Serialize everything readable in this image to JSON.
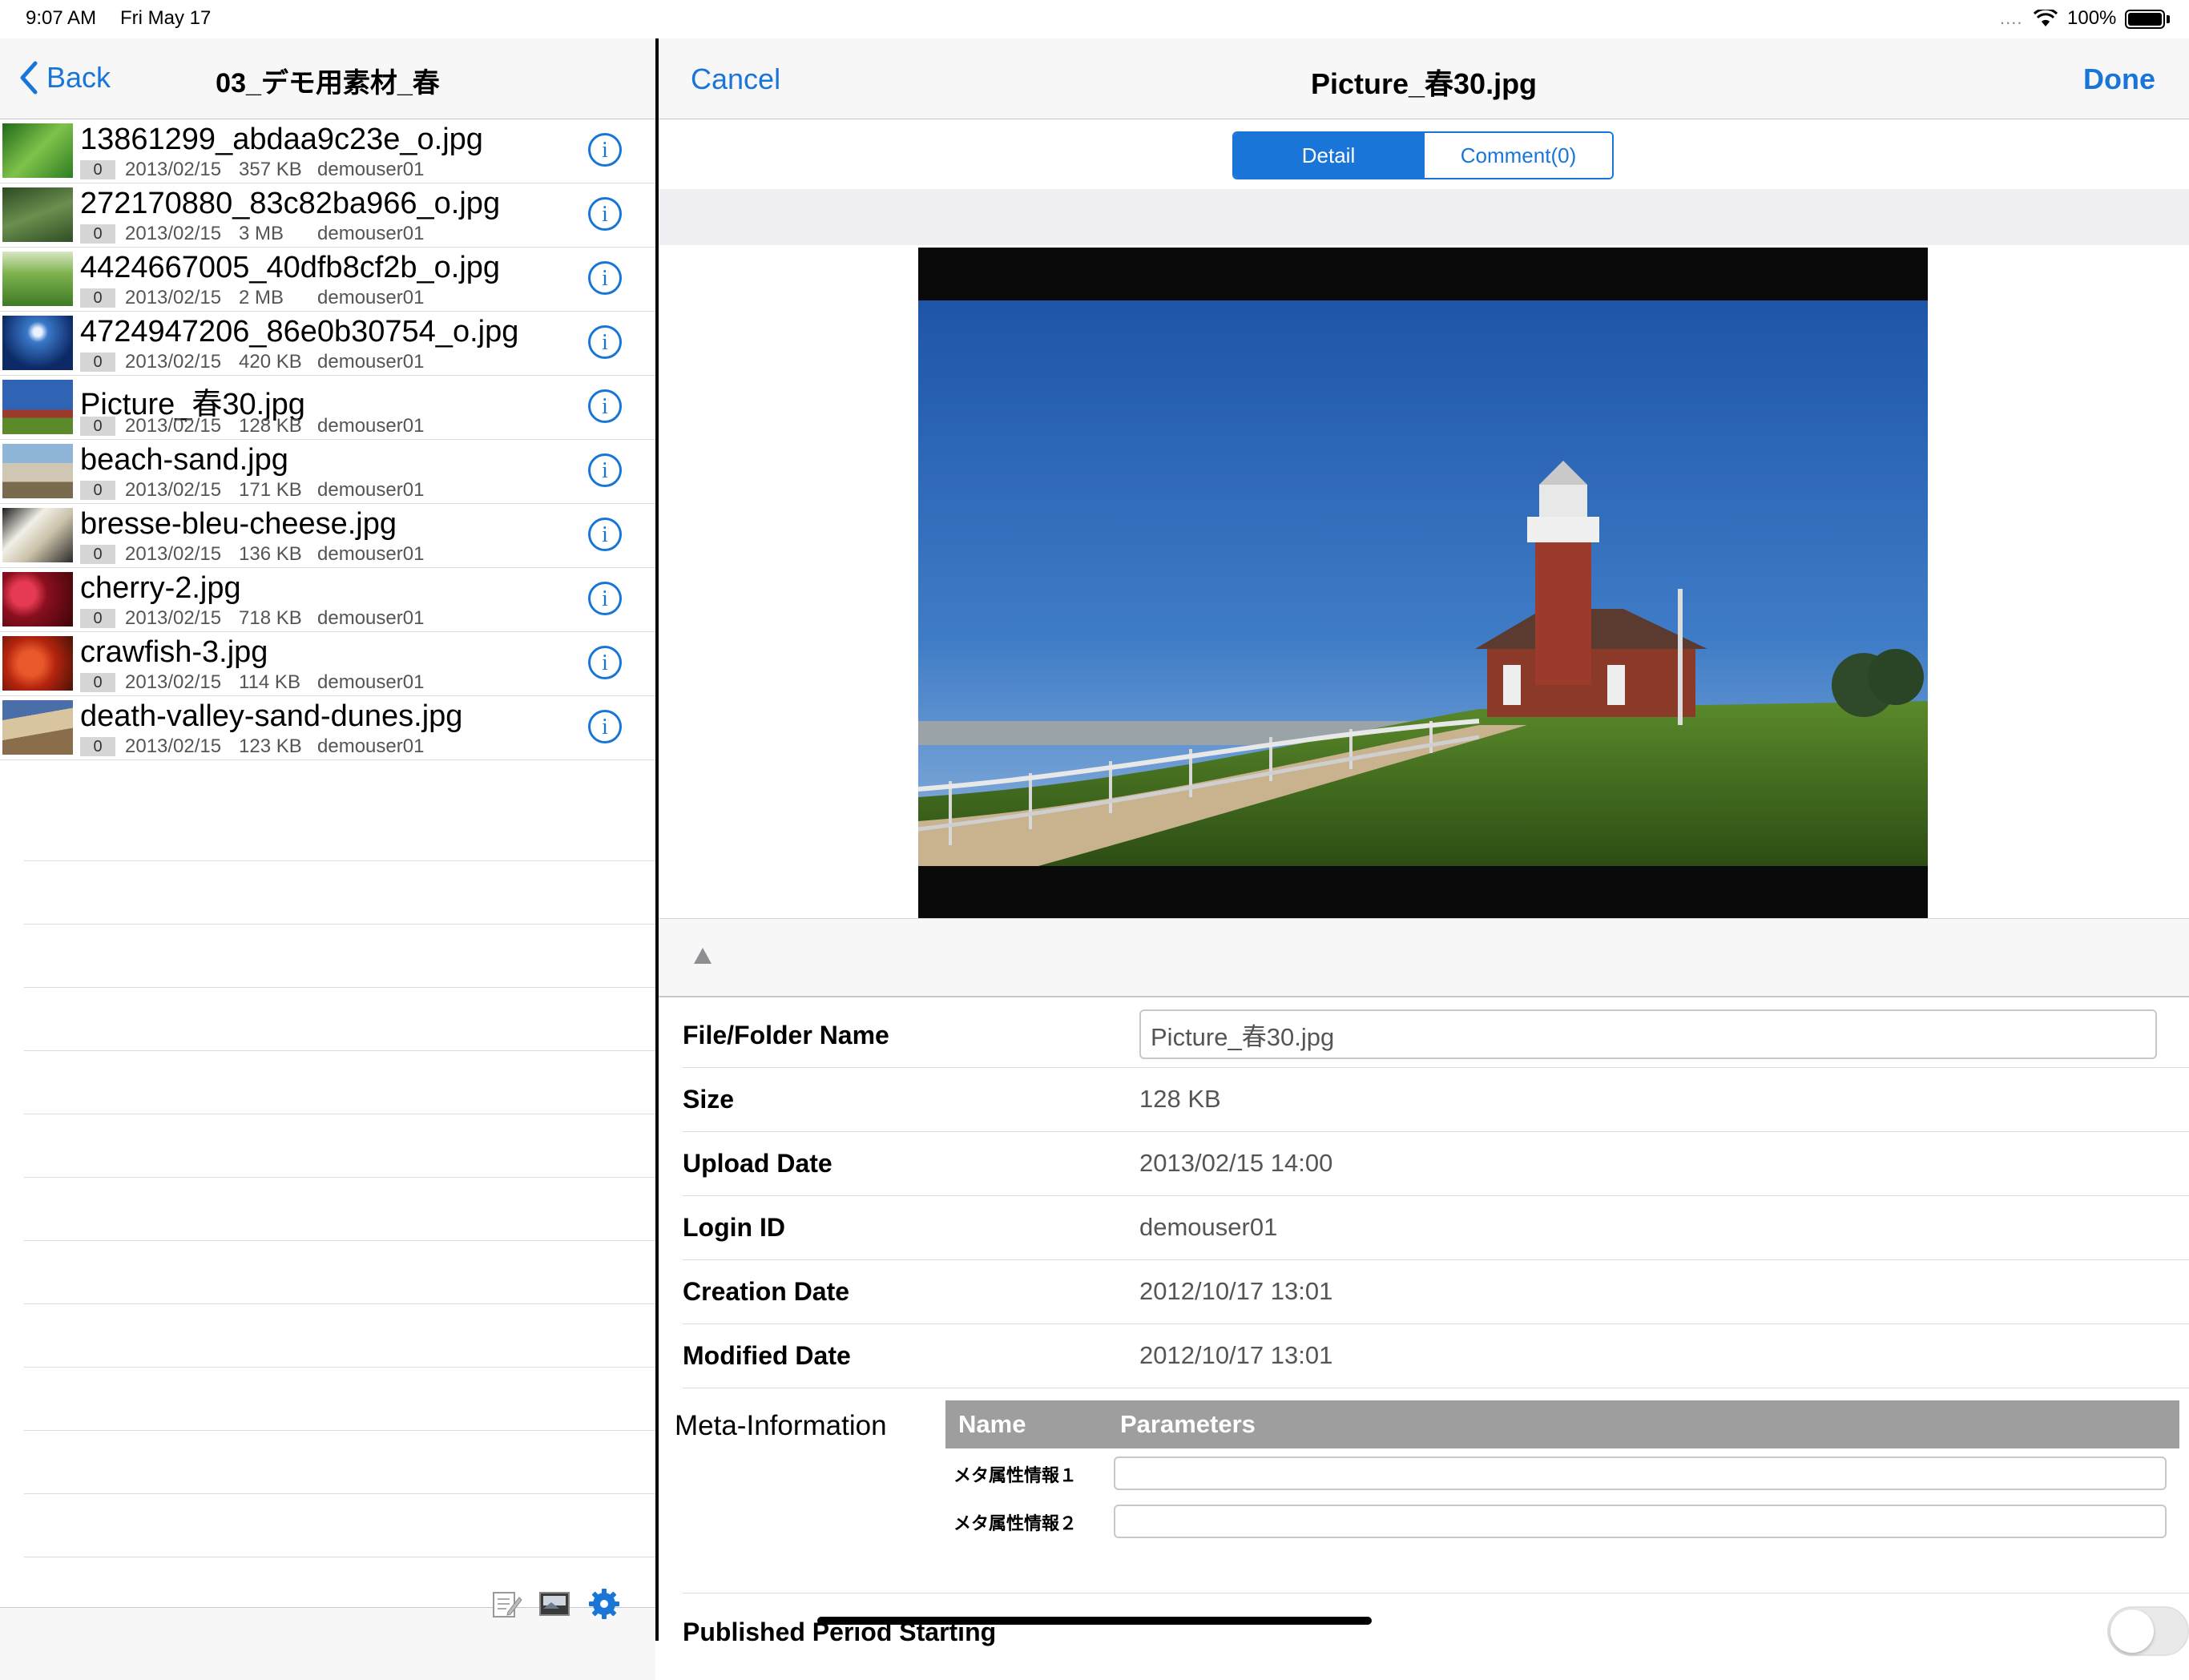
{
  "status_bar": {
    "time": "9:07 AM",
    "date": "Fri May 17",
    "signal_dots": "....",
    "battery_pct": "100%",
    "battery_level": 1.0
  },
  "left": {
    "back_label": "Back",
    "title": "03_デモ用素材_春",
    "files": [
      {
        "name": "13861299_abdaa9c23e_o.jpg",
        "count": "0",
        "date": "2013/02/15",
        "size": "357 KB",
        "user": "demouser01",
        "thumb": "green-grass"
      },
      {
        "name": "272170880_83c82ba966_o.jpg",
        "count": "0",
        "date": "2013/02/15",
        "size": "3 MB",
        "user": "demouser01",
        "thumb": "grass-dark"
      },
      {
        "name": "4424667005_40dfb8cf2b_o.jpg",
        "count": "0",
        "date": "2013/02/15",
        "size": "2 MB",
        "user": "demouser01",
        "thumb": "grass-light"
      },
      {
        "name": "4724947206_86e0b30754_o.jpg",
        "count": "0",
        "date": "2013/02/15",
        "size": "420 KB",
        "user": "demouser01",
        "thumb": "night-sky"
      },
      {
        "name": "Picture_春30.jpg",
        "count": "0",
        "date": "2013/02/15",
        "size": "128 KB",
        "user": "demouser01",
        "thumb": "lighthouse"
      },
      {
        "name": "beach-sand.jpg",
        "count": "0",
        "date": "2013/02/15",
        "size": "171 KB",
        "user": "demouser01",
        "thumb": "beach"
      },
      {
        "name": "bresse-bleu-cheese.jpg",
        "count": "0",
        "date": "2013/02/15",
        "size": "136 KB",
        "user": "demouser01",
        "thumb": "cheese"
      },
      {
        "name": "cherry-2.jpg",
        "count": "0",
        "date": "2013/02/15",
        "size": "718 KB",
        "user": "demouser01",
        "thumb": "cherry"
      },
      {
        "name": "crawfish-3.jpg",
        "count": "0",
        "date": "2013/02/15",
        "size": "114 KB",
        "user": "demouser01",
        "thumb": "crawfish"
      },
      {
        "name": "death-valley-sand-dunes.jpg",
        "count": "0",
        "date": "2013/02/15",
        "size": "123 KB",
        "user": "demouser01",
        "thumb": "dunes"
      }
    ],
    "toolbar_icons": [
      "edit-icon",
      "image-icon",
      "settings-gear-icon"
    ]
  },
  "right": {
    "cancel_label": "Cancel",
    "title": "Picture_春30.jpg",
    "done_label": "Done",
    "tabs": {
      "detail": "Detail",
      "comment": "Comment(0)"
    },
    "details": {
      "name_label": "File/Folder Name",
      "name_value": "Picture_春30.jpg",
      "size_label": "Size",
      "size_value": "128 KB",
      "upload_label": "Upload Date",
      "upload_value": "2013/02/15 14:00",
      "login_label": "Login ID",
      "login_value": "demouser01",
      "created_label": "Creation Date",
      "created_value": "2012/10/17 13:01",
      "modified_label": "Modified Date",
      "modified_value": "2012/10/17 13:01"
    },
    "meta": {
      "label": "Meta-Information",
      "col_name": "Name",
      "col_params": "Parameters",
      "rows": [
        {
          "name": "メタ属性情報１",
          "value": ""
        },
        {
          "name": "メタ属性情報２",
          "value": ""
        }
      ]
    },
    "published_label": "Published Period Starting"
  },
  "colors": {
    "accent": "#1a75d8",
    "header_bg": "#f7f7f7",
    "table_head": "#9e9e9e"
  }
}
